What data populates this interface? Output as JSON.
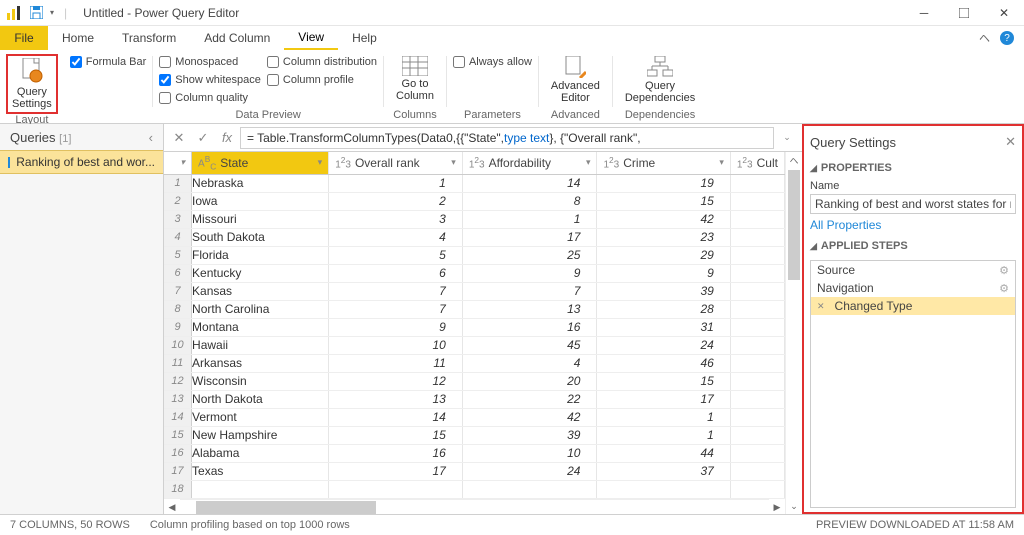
{
  "titlebar": {
    "doc": "Untitled",
    "app": "Power Query Editor"
  },
  "tabs": {
    "file": "File",
    "home": "Home",
    "transform": "Transform",
    "addcol": "Add Column",
    "view": "View",
    "help": "Help"
  },
  "ribbon": {
    "querysettings": "Query\nSettings",
    "layout": "Layout",
    "formulabar": "Formula Bar",
    "monospaced": "Monospaced",
    "showws": "Show whitespace",
    "colqual": "Column quality",
    "coldist": "Column distribution",
    "colprof": "Column profile",
    "datapreview": "Data Preview",
    "gotocol": "Go to\nColumn",
    "columns": "Columns",
    "alwaysallow": "Always allow",
    "parameters": "Parameters",
    "adveditor": "Advanced\nEditor",
    "advanced": "Advanced",
    "querydeps": "Query\nDependencies",
    "deps": "Dependencies"
  },
  "queries": {
    "title": "Queries",
    "count": "[1]",
    "item": "Ranking of best and wor..."
  },
  "formula": {
    "prefix": "= Table.TransformColumnTypes(Data0,{{\"State\", ",
    "kw1": "type text",
    "mid": "}, {\"Overall rank\","
  },
  "cols": {
    "state": "State",
    "rank": "Overall rank",
    "afford": "Affordability",
    "crime": "Crime",
    "cult": "Cult"
  },
  "rows": [
    {
      "n": 1,
      "state": "Nebraska",
      "rank": 1,
      "aff": 14,
      "crime": 19
    },
    {
      "n": 2,
      "state": "Iowa",
      "rank": 2,
      "aff": 8,
      "crime": 15
    },
    {
      "n": 3,
      "state": "Missouri",
      "rank": 3,
      "aff": 1,
      "crime": 42
    },
    {
      "n": 4,
      "state": "South Dakota",
      "rank": 4,
      "aff": 17,
      "crime": 23
    },
    {
      "n": 5,
      "state": "Florida",
      "rank": 5,
      "aff": 25,
      "crime": 29
    },
    {
      "n": 6,
      "state": "Kentucky",
      "rank": 6,
      "aff": 9,
      "crime": 9
    },
    {
      "n": 7,
      "state": "Kansas",
      "rank": 7,
      "aff": 7,
      "crime": 39
    },
    {
      "n": 8,
      "state": "North Carolina",
      "rank": 7,
      "aff": 13,
      "crime": 28
    },
    {
      "n": 9,
      "state": "Montana",
      "rank": 9,
      "aff": 16,
      "crime": 31
    },
    {
      "n": 10,
      "state": "Hawaii",
      "rank": 10,
      "aff": 45,
      "crime": 24
    },
    {
      "n": 11,
      "state": "Arkansas",
      "rank": 11,
      "aff": 4,
      "crime": 46
    },
    {
      "n": 12,
      "state": "Wisconsin",
      "rank": 12,
      "aff": 20,
      "crime": 15
    },
    {
      "n": 13,
      "state": "North Dakota",
      "rank": 13,
      "aff": 22,
      "crime": 17
    },
    {
      "n": 14,
      "state": "Vermont",
      "rank": 14,
      "aff": 42,
      "crime": 1
    },
    {
      "n": 15,
      "state": "New Hampshire",
      "rank": 15,
      "aff": 39,
      "crime": 1
    },
    {
      "n": 16,
      "state": "Alabama",
      "rank": 16,
      "aff": 10,
      "crime": 44
    },
    {
      "n": 17,
      "state": "Texas",
      "rank": 17,
      "aff": 24,
      "crime": 37
    },
    {
      "n": 18,
      "state": "",
      "rank": "",
      "aff": "",
      "crime": ""
    }
  ],
  "settings": {
    "title": "Query Settings",
    "properties": "PROPERTIES",
    "namelabel": "Name",
    "name": "Ranking of best and worst states for retire",
    "allprops": "All Properties",
    "applied": "APPLIED STEPS",
    "steps": {
      "s1": "Source",
      "s2": "Navigation",
      "s3": "Changed Type"
    }
  },
  "status": {
    "cols": "7 COLUMNS, 50 ROWS",
    "prof": "Column profiling based on top 1000 rows",
    "preview": "PREVIEW DOWNLOADED AT 11:58 AM"
  }
}
